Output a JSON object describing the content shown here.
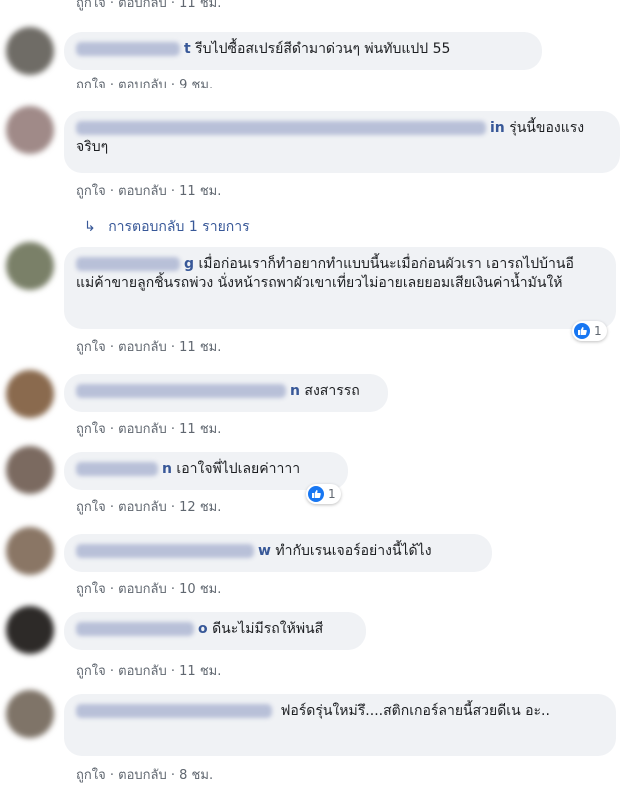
{
  "meta_like": "ถูกใจ",
  "meta_reply": "ตอบกลับ",
  "meta_sep": "·",
  "top_meta_time": "11 ชม.",
  "comments": [
    {
      "name_tail": "t",
      "text": "รีบไปซื้อสเปรย์สีดำมาด่วนๆ พ่นทับแปป 55",
      "time": "9 ชม."
    },
    {
      "name_tail": "in",
      "text": "รุ่นนี้ของแรง จริบๆ",
      "time": "11 ชม."
    },
    {
      "name_tail": "g",
      "text": "เมื่อก่อนเราก็ทำอยากทำแบบนี้นะเมื่อก่อนผัวเรา เอารถไปบ้านอีแม่ค้าขายลูกชิ้นรถพ่วง นั่งหน้ารถพาผัวเขาเที่ยวไม่อายเลยยอมเสียเงินค่าน้ำมันให้",
      "time": "11 ชม.",
      "reactions": "1"
    },
    {
      "name_tail": "n",
      "text": "สงสารรถ",
      "time": "11 ชม."
    },
    {
      "name_tail": "n",
      "text": "เอาใจพี่ไปเลยค่าาาา",
      "time": "12 ชม.",
      "reactions": "1"
    },
    {
      "name_tail": "w",
      "text": "ทำกับเรนเจอร์อย่างนี้ได้ไง",
      "time": "10 ชม."
    },
    {
      "name_tail": "o",
      "text": "ดีนะไม่มีรถให้พ่นสี",
      "time": "11 ชม."
    },
    {
      "name_tail": "",
      "text": "ฟอร์ดรุ่นใหม่รึ....สติกเกอร์ลายนี้สวยดีเน อะ..",
      "time": "8 ชม."
    }
  ],
  "replies_link": "การตอบกลับ 1 รายการ",
  "colors": {
    "link": "#385898",
    "bubble": "#f0f2f5",
    "like_blue": "#1877f2",
    "meta": "#606770"
  }
}
